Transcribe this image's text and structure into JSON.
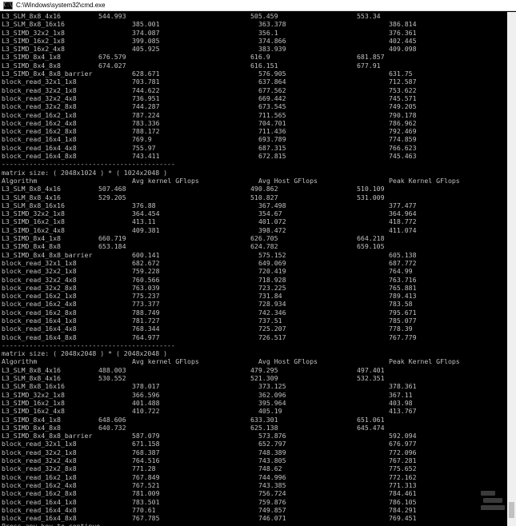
{
  "window": {
    "title": "C:\\Windows\\system32\\cmd.exe",
    "icon_label": "C:\\"
  },
  "console": {
    "sections": [
      {
        "header": null,
        "rows": [
          {
            "algorithm": "L3_SLM_8x8_4x16",
            "avg_kernel": "544.993",
            "avg_host": "505.459",
            "peak_kernel": "553.34",
            "short": true
          },
          {
            "algorithm": "L3_SLM_8x8_16x16",
            "avg_kernel": "385.001",
            "avg_host": "363.378",
            "peak_kernel": "386.814",
            "short": false
          },
          {
            "algorithm": "L3_SIMD_32x2_1x8",
            "avg_kernel": "374.087",
            "avg_host": "356.1",
            "peak_kernel": "376.361",
            "short": false
          },
          {
            "algorithm": "L3_SIMD_16x2_1x8",
            "avg_kernel": "399.085",
            "avg_host": "374.866",
            "peak_kernel": "402.445",
            "short": false
          },
          {
            "algorithm": "L3_SIMD_16x2_4x8",
            "avg_kernel": "405.925",
            "avg_host": "383.939",
            "peak_kernel": "409.098",
            "short": false
          },
          {
            "algorithm": "L3_SIMD_8x4_1x8",
            "avg_kernel": "676.579",
            "avg_host": "616.9",
            "peak_kernel": "681.857",
            "short": true
          },
          {
            "algorithm": "L3_SIMD_8x4_8x8",
            "avg_kernel": "674.027",
            "avg_host": "616.151",
            "peak_kernel": "677.91",
            "short": true
          },
          {
            "algorithm": "L3_SIMD_8x4_8x8_barrier",
            "avg_kernel": "628.671",
            "avg_host": "576.905",
            "peak_kernel": "631.75",
            "short": false
          },
          {
            "algorithm": "block_read_32x1_1x8",
            "avg_kernel": "703.781",
            "avg_host": "637.864",
            "peak_kernel": "712.587",
            "short": false
          },
          {
            "algorithm": "block_read_32x2_1x8",
            "avg_kernel": "744.622",
            "avg_host": "677.562",
            "peak_kernel": "753.622",
            "short": false
          },
          {
            "algorithm": "block_read_32x2_4x8",
            "avg_kernel": "736.951",
            "avg_host": "669.442",
            "peak_kernel": "745.571",
            "short": false
          },
          {
            "algorithm": "block_read_32x2_8x8",
            "avg_kernel": "744.287",
            "avg_host": "673.545",
            "peak_kernel": "749.205",
            "short": false
          },
          {
            "algorithm": "block_read_16x2_1x8",
            "avg_kernel": "787.224",
            "avg_host": "711.565",
            "peak_kernel": "790.178",
            "short": false
          },
          {
            "algorithm": "block_read_16x2_4x8",
            "avg_kernel": "783.336",
            "avg_host": "704.701",
            "peak_kernel": "786.962",
            "short": false
          },
          {
            "algorithm": "block_read_16x2_8x8",
            "avg_kernel": "788.172",
            "avg_host": "711.436",
            "peak_kernel": "792.469",
            "short": false
          },
          {
            "algorithm": "block_read_16x4_1x8",
            "avg_kernel": "769.9",
            "avg_host": "693.789",
            "peak_kernel": "774.859",
            "short": false
          },
          {
            "algorithm": "block_read_16x4_4x8",
            "avg_kernel": "755.97",
            "avg_host": "687.315",
            "peak_kernel": "766.623",
            "short": false
          },
          {
            "algorithm": "block_read_16x4_8x8",
            "avg_kernel": "743.411",
            "avg_host": "672.815",
            "peak_kernel": "745.463",
            "short": false
          }
        ]
      },
      {
        "header": {
          "matrix_line": "matrix size: ( 2048x1024 ) * ( 1024x2048 )",
          "col_algorithm": "Algorithm",
          "col_avg_kernel": "Avg kernel GFlops",
          "col_avg_host": "Avg Host GFlops",
          "col_peak_kernel": "Peak Kernel GFlops"
        },
        "rows": [
          {
            "algorithm": "L3_SLM_8x8_4x16",
            "avg_kernel": "507.468",
            "avg_host": "490.862",
            "peak_kernel": "510.109",
            "short": true
          },
          {
            "algorithm": "L3_SLM_8x8_4x16",
            "avg_kernel": "529.205",
            "avg_host": "510.827",
            "peak_kernel": "531.009",
            "short": true
          },
          {
            "algorithm": "L3_SLM_8x8_16x16",
            "avg_kernel": "376.88",
            "avg_host": "367.498",
            "peak_kernel": "377.477",
            "short": false
          },
          {
            "algorithm": "L3_SIMD_32x2_1x8",
            "avg_kernel": "364.454",
            "avg_host": "354.67",
            "peak_kernel": "364.964",
            "short": false
          },
          {
            "algorithm": "L3_SIMD_16x2_1x8",
            "avg_kernel": "413.11",
            "avg_host": "401.072",
            "peak_kernel": "418.772",
            "short": false
          },
          {
            "algorithm": "L3_SIMD_16x2_4x8",
            "avg_kernel": "409.381",
            "avg_host": "398.472",
            "peak_kernel": "411.074",
            "short": false
          },
          {
            "algorithm": "L3_SIMD_8x4_1x8",
            "avg_kernel": "660.719",
            "avg_host": "626.705",
            "peak_kernel": "664.218",
            "short": true
          },
          {
            "algorithm": "L3_SIMD_8x4_8x8",
            "avg_kernel": "653.184",
            "avg_host": "624.782",
            "peak_kernel": "659.105",
            "short": true
          },
          {
            "algorithm": "L3_SIMD_8x4_8x8_barrier",
            "avg_kernel": "600.141",
            "avg_host": "575.152",
            "peak_kernel": "605.138",
            "short": false
          },
          {
            "algorithm": "block_read_32x1_1x8",
            "avg_kernel": "682.672",
            "avg_host": "649.069",
            "peak_kernel": "687.772",
            "short": false
          },
          {
            "algorithm": "block_read_32x2_1x8",
            "avg_kernel": "759.228",
            "avg_host": "720.419",
            "peak_kernel": "764.99",
            "short": false
          },
          {
            "algorithm": "block_read_32x2_4x8",
            "avg_kernel": "760.566",
            "avg_host": "718.928",
            "peak_kernel": "763.716",
            "short": false
          },
          {
            "algorithm": "block_read_32x2_8x8",
            "avg_kernel": "763.039",
            "avg_host": "723.225",
            "peak_kernel": "765.881",
            "short": false
          },
          {
            "algorithm": "block_read_16x2_1x8",
            "avg_kernel": "775.237",
            "avg_host": "731.84",
            "peak_kernel": "789.413",
            "short": false
          },
          {
            "algorithm": "block_read_16x2_4x8",
            "avg_kernel": "773.377",
            "avg_host": "728.934",
            "peak_kernel": "783.58",
            "short": false
          },
          {
            "algorithm": "block_read_16x2_8x8",
            "avg_kernel": "788.749",
            "avg_host": "742.346",
            "peak_kernel": "795.671",
            "short": false
          },
          {
            "algorithm": "block_read_16x4_1x8",
            "avg_kernel": "781.727",
            "avg_host": "737.51",
            "peak_kernel": "785.077",
            "short": false
          },
          {
            "algorithm": "block_read_16x4_4x8",
            "avg_kernel": "768.344",
            "avg_host": "725.207",
            "peak_kernel": "778.39",
            "short": false
          },
          {
            "algorithm": "block_read_16x4_8x8",
            "avg_kernel": "764.977",
            "avg_host": "726.517",
            "peak_kernel": "767.779",
            "short": false
          }
        ]
      },
      {
        "header": {
          "matrix_line": "matrix size: ( 2048x2048 ) * ( 2048x2048 )",
          "col_algorithm": "Algorithm",
          "col_avg_kernel": "Avg kernel GFlops",
          "col_avg_host": "Avg Host GFlops",
          "col_peak_kernel": "Peak Kernel GFlops"
        },
        "rows": [
          {
            "algorithm": "L3_SLM_8x8_4x16",
            "avg_kernel": "488.003",
            "avg_host": "479.295",
            "peak_kernel": "497.401",
            "short": true
          },
          {
            "algorithm": "L3_SLM_8x8_4x16",
            "avg_kernel": "530.552",
            "avg_host": "521.309",
            "peak_kernel": "532.351",
            "short": true
          },
          {
            "algorithm": "L3_SLM_8x8_16x16",
            "avg_kernel": "378.017",
            "avg_host": "373.125",
            "peak_kernel": "378.361",
            "short": false
          },
          {
            "algorithm": "L3_SIMD_32x2_1x8",
            "avg_kernel": "366.596",
            "avg_host": "362.096",
            "peak_kernel": "367.11",
            "short": false
          },
          {
            "algorithm": "L3_SIMD_16x2_1x8",
            "avg_kernel": "401.488",
            "avg_host": "395.964",
            "peak_kernel": "403.98",
            "short": false
          },
          {
            "algorithm": "L3_SIMD_16x2_4x8",
            "avg_kernel": "410.722",
            "avg_host": "405.19",
            "peak_kernel": "413.767",
            "short": false
          },
          {
            "algorithm": "L3_SIMD_8x4_1x8",
            "avg_kernel": "648.606",
            "avg_host": "633.301",
            "peak_kernel": "651.061",
            "short": true
          },
          {
            "algorithm": "L3_SIMD_8x4_8x8",
            "avg_kernel": "640.732",
            "avg_host": "625.138",
            "peak_kernel": "645.474",
            "short": true
          },
          {
            "algorithm": "L3_SIMD_8x4_8x8_barrier",
            "avg_kernel": "587.079",
            "avg_host": "573.876",
            "peak_kernel": "592.094",
            "short": false
          },
          {
            "algorithm": "block_read_32x1_1x8",
            "avg_kernel": "671.158",
            "avg_host": "652.797",
            "peak_kernel": "676.977",
            "short": false
          },
          {
            "algorithm": "block_read_32x2_1x8",
            "avg_kernel": "768.387",
            "avg_host": "748.389",
            "peak_kernel": "772.096",
            "short": false
          },
          {
            "algorithm": "block_read_32x2_4x8",
            "avg_kernel": "764.516",
            "avg_host": "743.805",
            "peak_kernel": "767.281",
            "short": false
          },
          {
            "algorithm": "block_read_32x2_8x8",
            "avg_kernel": "771.28",
            "avg_host": "748.62",
            "peak_kernel": "775.652",
            "short": false
          },
          {
            "algorithm": "block_read_16x2_1x8",
            "avg_kernel": "767.849",
            "avg_host": "744.996",
            "peak_kernel": "772.162",
            "short": false
          },
          {
            "algorithm": "block_read_16x2_4x8",
            "avg_kernel": "767.521",
            "avg_host": "743.385",
            "peak_kernel": "771.313",
            "short": false
          },
          {
            "algorithm": "block_read_16x2_8x8",
            "avg_kernel": "781.009",
            "avg_host": "756.724",
            "peak_kernel": "784.461",
            "short": false
          },
          {
            "algorithm": "block_read_16x4_1x8",
            "avg_kernel": "783.501",
            "avg_host": "759.876",
            "peak_kernel": "786.105",
            "short": false
          },
          {
            "algorithm": "block_read_16x4_4x8",
            "avg_kernel": "770.61",
            "avg_host": "749.857",
            "peak_kernel": "784.291",
            "short": false
          },
          {
            "algorithm": "block_read_16x4_8x8",
            "avg_kernel": "767.785",
            "avg_host": "746.071",
            "peak_kernel": "769.451",
            "short": false
          }
        ]
      }
    ],
    "separator": "--------------------------------------------",
    "prompt": "Press any key to continue . . ."
  }
}
